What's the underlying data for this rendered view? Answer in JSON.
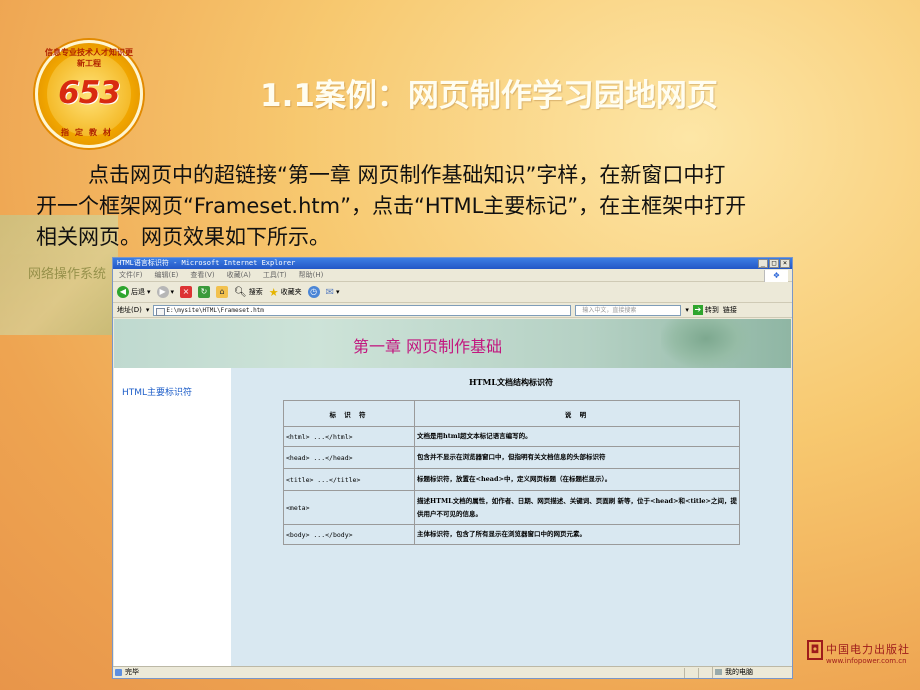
{
  "slide": {
    "title": "1.1案例：网页制作学习园地网页",
    "paragraph_lines": [
      "点击网页中的超链接“第一章 网页制作基础知识”字样，在新窗口中打",
      "开一个框架网页“Frameset.htm”，点击“HTML主要标记”，在主框架中打开",
      "相关网页。网页效果如下所示。"
    ],
    "background_book_text": "网络操作系统",
    "logo": {
      "number": "653",
      "rim_top": "信息专业技术人才知识更新工程",
      "rim_bottom": "指定教材"
    },
    "publisher": {
      "name": "中国电力出版社",
      "url": "www.infopower.com.cn"
    }
  },
  "browser": {
    "window_title": "HTML语言标识符 - Microsoft Internet Explorer",
    "window_buttons": [
      "_",
      "□",
      "×"
    ],
    "menu": [
      "文件(F)",
      "编辑(E)",
      "查看(V)",
      "收藏(A)",
      "工具(T)",
      "帮助(H)"
    ],
    "toolbar": {
      "back": "后退",
      "search": "搜索",
      "favorites": "收藏夹"
    },
    "address_label": "地址(D)",
    "address_value": "E:\\mysite\\HTML\\Frameset.htm",
    "search_placeholder": "输入中文，直接搜索",
    "go_label": "转到",
    "links_label": "链接",
    "status_text": "完毕",
    "status_zone": "我的电脑"
  },
  "page": {
    "banner_title": "第一章  网页制作基础",
    "left_link": "HTML主要标识符",
    "table_title": "HTML文档结构标识符",
    "table_headers": [
      "标 识 符",
      "说  明"
    ],
    "table_rows": [
      {
        "tag": "<html> ...</html>",
        "desc": "文档是用html超文本标记语言编写的。"
      },
      {
        "tag": "<head> ...</head>",
        "desc": "包含并不显示在浏览器窗口中，但指明有关文档信息的头部标识符"
      },
      {
        "tag": "<title> ...</title>",
        "desc": "标题标识符，放置在<head>中，定义网页标题（在标题栏显示）。"
      },
      {
        "tag": "<meta>",
        "desc": "描述HTML文档的属性，如作者、日期、网页描述、关键词、页面刷 新等，位于<head>和<title>之间，提供用户不可见的信息。"
      },
      {
        "tag": "<body> ...</body>",
        "desc": "主体标识符，包含了所有显示在浏览器窗口中的网页元素。"
      }
    ]
  }
}
